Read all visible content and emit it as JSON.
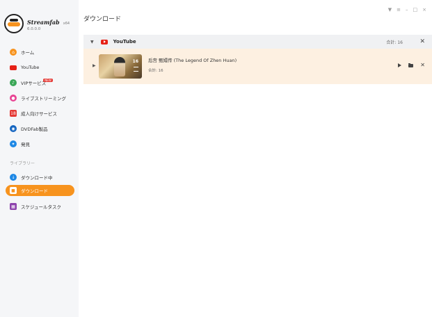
{
  "app": {
    "name": "Streamfab",
    "arch": "x64",
    "version": "6.0.0.0"
  },
  "window_controls": [
    "▼",
    "≡",
    "–",
    "□",
    "×"
  ],
  "page_title": "ダウンロード",
  "sidebar": {
    "items": [
      {
        "label": "ホーム",
        "icon": "home-icon",
        "color": "#f7931e"
      },
      {
        "label": "YouTube",
        "icon": "youtube-icon",
        "color": "#e62117"
      },
      {
        "label": "VIPサービス",
        "icon": "vip-icon",
        "color": "#3aa757",
        "badge": "NEW"
      },
      {
        "label": "ライブストリーミング",
        "icon": "live-icon",
        "color": "#e84393"
      },
      {
        "label": "成人向けサービス",
        "icon": "adult-icon",
        "color": "#e53935"
      },
      {
        "label": "DVDFab製品",
        "icon": "dvdfab-icon",
        "color": "#1565c0"
      },
      {
        "label": "発見",
        "icon": "discover-icon",
        "color": "#1e88e5"
      }
    ],
    "library_label": "ライブラリー",
    "library": [
      {
        "label": "ダウンロード中",
        "icon": "downloading-icon",
        "color": "#1e88e5"
      },
      {
        "label": "ダウンロード",
        "icon": "downloaded-icon",
        "color": "#f7931e",
        "active": true
      },
      {
        "label": "スケジュールタスク",
        "icon": "schedule-icon",
        "color": "#8e44ad"
      }
    ]
  },
  "group": {
    "name": "YouTube",
    "total": "合計: 16"
  },
  "item": {
    "title": "后宫 甄嬛传 (The Legend Of Zhen Huan)",
    "total": "合計: 16",
    "thumb_count": "16"
  }
}
